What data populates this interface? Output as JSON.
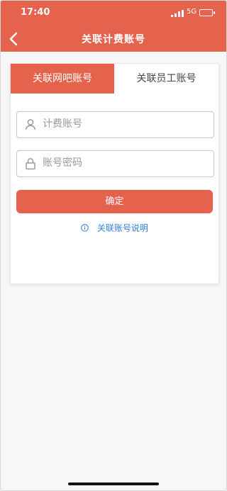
{
  "status_bar": {
    "time": "17:40",
    "network": "5G"
  },
  "header": {
    "title": "关联计费账号"
  },
  "tabs": [
    {
      "label": "关联网吧账号",
      "active": true
    },
    {
      "label": "关联员工账号",
      "active": false
    }
  ],
  "form": {
    "account_placeholder": "计费账号",
    "password_placeholder": "账号密码",
    "confirm_label": "确定",
    "help_text": "关联账号说明"
  },
  "colors": {
    "accent": "#e5634d",
    "link": "#2f7ed8"
  },
  "icons": [
    "back-arrow-icon",
    "signal-icon",
    "battery-icon",
    "user-icon",
    "lock-icon",
    "info-icon"
  ]
}
